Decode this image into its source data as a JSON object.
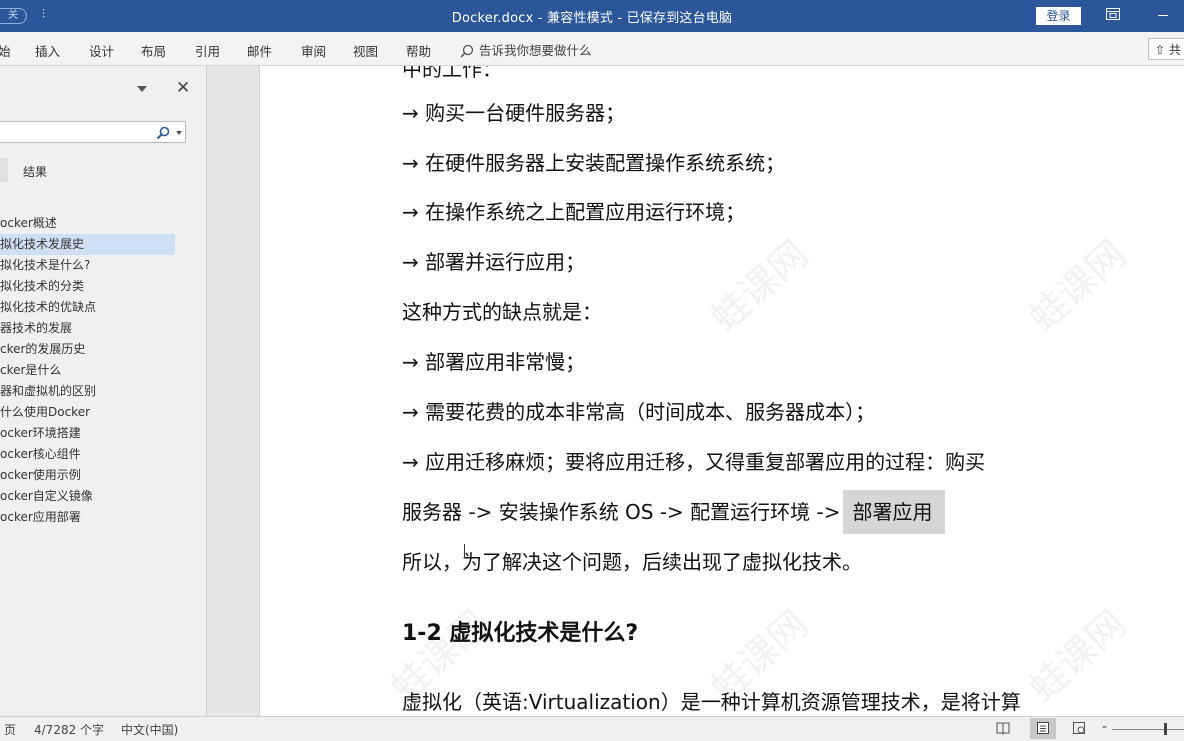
{
  "titlebar": {
    "toggle": "关",
    "quick_access": "⫶",
    "title": "Docker.docx  -  兼容性模式  -  已保存到这台电脑",
    "login": "登录"
  },
  "ribbon": {
    "tabs": [
      "始",
      "插入",
      "设计",
      "布局",
      "引用",
      "邮件",
      "审阅",
      "视图",
      "帮助"
    ],
    "tell_me": "告诉我你想要做什么",
    "share": "共"
  },
  "nav": {
    "results_label": "结果",
    "items": [
      "ocker概述",
      "拟化技术发展史",
      "拟化技术是什么?",
      "拟化技术的分类",
      "拟化技术的优缺点",
      "器技术的发展",
      "cker的发展历史",
      "cker是什么",
      "器和虚拟机的区别",
      "什么使用Docker",
      "ocker环境搭建",
      "ocker核心组件",
      "ocker使用示例",
      "ocker自定义镜像",
      "ocker应用部署"
    ],
    "selected_index": 1
  },
  "document": {
    "partial_top": "中的工作：",
    "lines": [
      "→  购买一台硬件服务器；",
      "→  在硬件服务器上安装配置操作系统系统；",
      "→  在操作系统之上配置应用运行环境；",
      "→  部署并运行应用；",
      "这种方式的缺点就是：",
      "→  部署应用非常慢；",
      "→  需要花费的成本非常高（时间成本、服务器成本）；",
      "→  应用迁移麻烦；要将应用迁移，又得重复部署应用的过程：购买"
    ],
    "line9_text": "服务器  ->  安装操作系统 OS ->  配置运行环境  ->",
    "line9_highlight": "部署应用",
    "line10": "所以，为了解决这个问题，后续出现了虚拟化技术。",
    "heading": "1-2  虚拟化技术是什么?",
    "last_line": "虚拟化（英语:Virtualization）是一种计算机资源管理技术，是将计算",
    "watermark": "蛙课网"
  },
  "status": {
    "page": "页",
    "words": "4/7282 个字",
    "language": "中文(中国)",
    "zoom_minus": "-"
  }
}
